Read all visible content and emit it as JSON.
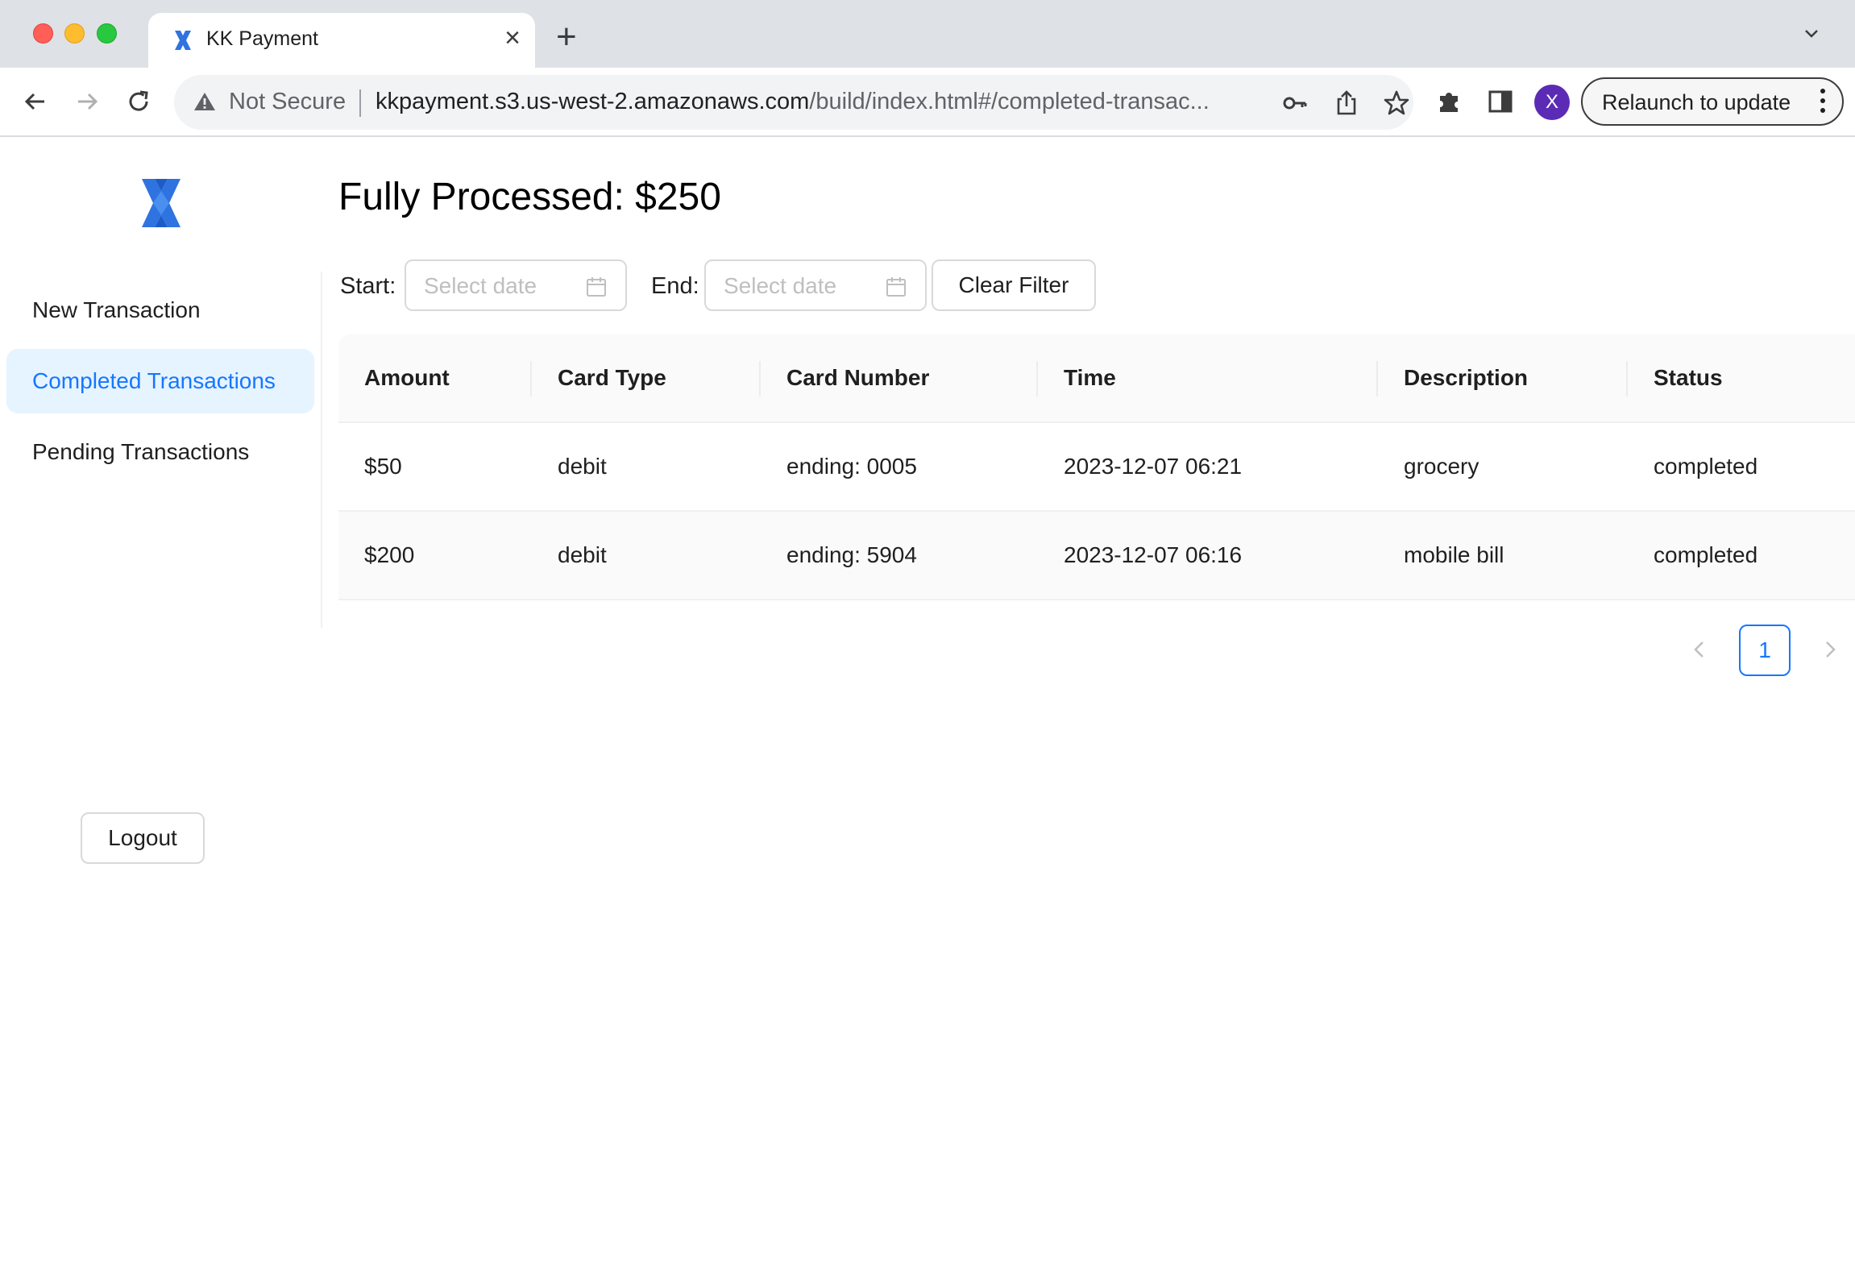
{
  "browser": {
    "tab_title": "KK Payment",
    "security_label": "Not Secure",
    "url_host": "kkpayment.s3.us-west-2.amazonaws.com",
    "url_path": "/build/index.html#/completed-transac...",
    "profile_initial": "X",
    "relaunch_label": "Relaunch to update"
  },
  "sidebar": {
    "items": [
      {
        "label": "New Transaction",
        "active": false
      },
      {
        "label": "Completed Transactions",
        "active": true
      },
      {
        "label": "Pending Transactions",
        "active": false
      }
    ],
    "logout_label": "Logout"
  },
  "main": {
    "title": "Fully Processed: $250",
    "filters": {
      "start_label": "Start:",
      "end_label": "End:",
      "start_placeholder": "Select date",
      "end_placeholder": "Select date",
      "clear_label": "Clear Filter"
    },
    "table": {
      "columns": [
        "Amount",
        "Card Type",
        "Card Number",
        "Time",
        "Description",
        "Status"
      ],
      "rows": [
        [
          "$50",
          "debit",
          "ending: 0005",
          "2023-12-07 06:21",
          "grocery",
          "completed"
        ],
        [
          "$200",
          "debit",
          "ending: 5904",
          "2023-12-07 06:16",
          "mobile bill",
          "completed"
        ]
      ]
    },
    "pagination": {
      "current_page": "1"
    }
  },
  "colors": {
    "accent": "#1677ff",
    "active_bg": "#e6f4ff",
    "logo": "#2f73e0"
  },
  "icons": {
    "logo": "x-logo-icon",
    "calendar": "calendar-icon",
    "prev": "chevron-left-icon",
    "next": "chevron-right-icon"
  }
}
